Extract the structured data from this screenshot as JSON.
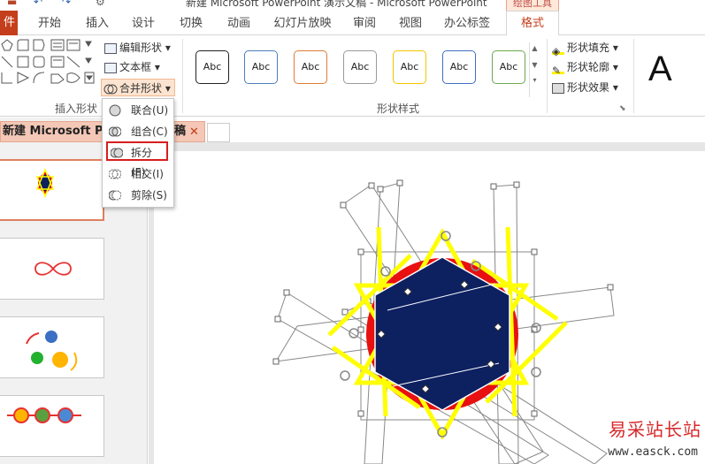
{
  "window": {
    "title": "新建 Microsoft PowerPoint 演示文稿 - Microsoft PowerPoint",
    "context_label": "绘图工具"
  },
  "tabs": [
    "件",
    "开始",
    "插入",
    "设计",
    "切换",
    "动画",
    "幻灯片放映",
    "审阅",
    "视图",
    "办公标签",
    "格式"
  ],
  "ribbon": {
    "insert_shapes_label": "插入形状",
    "edit_shape": "编辑形状",
    "text_box": "文本框",
    "merge_shapes": "合并形状",
    "shape_styles_label": "形状样式",
    "style_swatch_text": "Abc",
    "style_colors": [
      "#222222",
      "#4a7ebb",
      "#e07b39",
      "#9a9a9a",
      "#f5c400",
      "#3f6fbf",
      "#6aa84f"
    ],
    "shape_fill": "形状填充",
    "shape_outline": "形状轮廓",
    "shape_effects": "形状效果",
    "wordart_letter": "A"
  },
  "merge_menu": {
    "items": [
      {
        "label": "联合(U)",
        "icon": "union-icon"
      },
      {
        "label": "组合(C)",
        "icon": "combine-icon"
      },
      {
        "label": "拆分(F)",
        "icon": "fragment-icon"
      },
      {
        "label": "相交(I)",
        "icon": "intersect-icon"
      },
      {
        "label": "剪除(S)",
        "icon": "subtract-icon"
      }
    ]
  },
  "document_tab": {
    "title": "新建 Microsoft Pow",
    "title_tail": "稿",
    "close": "✕"
  },
  "colors": {
    "accent": "#c43e1c",
    "highlight_border": "#d81e1e",
    "hexagon_fill": "#0d2060",
    "circle_fill": "#e81010",
    "yellow_lines": "#ffff00"
  },
  "watermark": {
    "text": "易采站长站",
    "url": "www.easck.com"
  }
}
